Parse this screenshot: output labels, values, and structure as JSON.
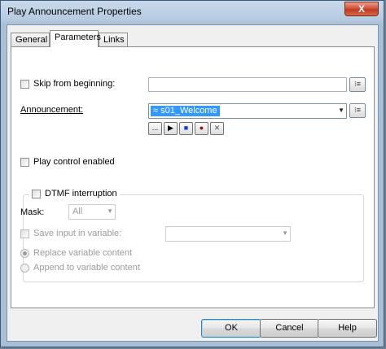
{
  "window": {
    "title": "Play Announcement Properties",
    "close_symbol": "X"
  },
  "tabs": [
    {
      "label": "General",
      "active": false
    },
    {
      "label": "Parameters",
      "active": true
    },
    {
      "label": "Links",
      "active": false
    }
  ],
  "skip": {
    "label": "Skip from beginning:",
    "checked": false,
    "value": "",
    "picker_symbol": "⁝≡"
  },
  "announcement": {
    "label": "Announcement:",
    "value": "≈ s01_Welcome",
    "picker_symbol": "⁝≡",
    "controls": {
      "browse_symbol": "...",
      "play_symbol": "▶",
      "stop_symbol": "■",
      "record_symbol": "●",
      "delete_symbol": "✕"
    },
    "colors": {
      "stop": "#1a3ccf",
      "record": "#8b1010",
      "selection": "#3399ff"
    }
  },
  "play_control": {
    "label": "Play control enabled",
    "checked": false
  },
  "dtmf": {
    "label": "DTMF interruption",
    "checked": false,
    "mask_label": "Mask:",
    "mask_value": "All",
    "save_label": "Save input in variable:",
    "save_checked": false,
    "save_value": "",
    "replace_label": "Replace variable content",
    "replace_selected": true,
    "append_label": "Append to variable content",
    "append_selected": false
  },
  "buttons": {
    "ok": "OK",
    "cancel": "Cancel",
    "help": "Help"
  }
}
